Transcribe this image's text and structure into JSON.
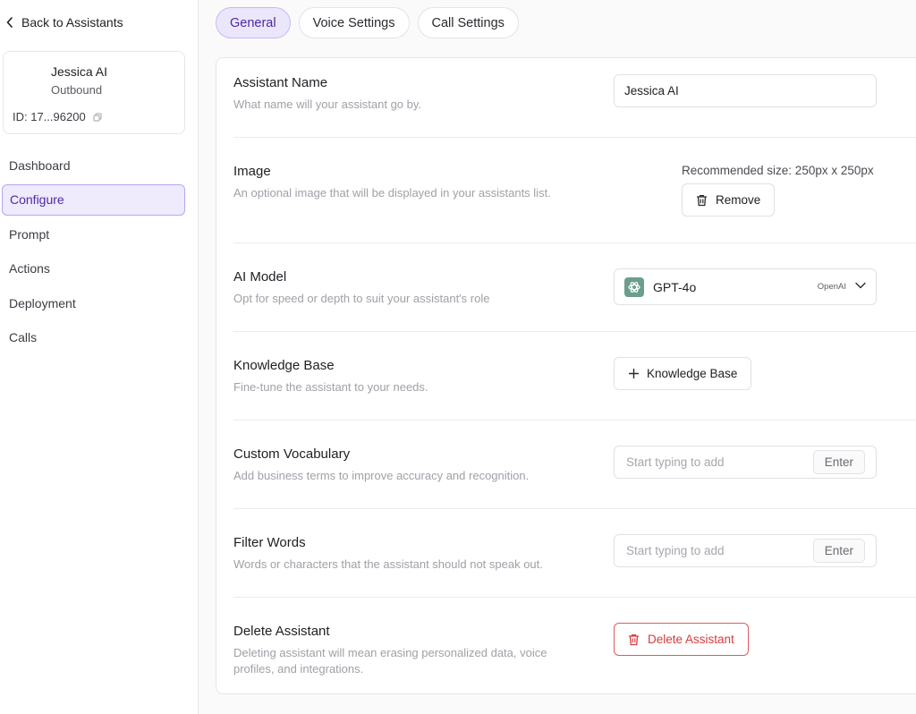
{
  "sidebar": {
    "back_label": "Back to Assistants",
    "profile": {
      "name": "Jessica AI",
      "type": "Outbound",
      "id": "ID: 17...96200"
    },
    "items": [
      {
        "label": "Dashboard"
      },
      {
        "label": "Configure"
      },
      {
        "label": "Prompt"
      },
      {
        "label": "Actions"
      },
      {
        "label": "Deployment"
      },
      {
        "label": "Calls"
      }
    ]
  },
  "tabs": [
    {
      "label": "General"
    },
    {
      "label": "Voice Settings"
    },
    {
      "label": "Call Settings"
    }
  ],
  "sections": {
    "name": {
      "title": "Assistant Name",
      "desc": "What name will your assistant go by.",
      "value": "Jessica AI"
    },
    "image": {
      "title": "Image",
      "desc": "An optional image that will be displayed in your assistants list.",
      "recommended": "Recommended size: 250px x 250px",
      "remove_label": "Remove"
    },
    "model": {
      "title": "AI Model",
      "desc": "Opt for speed or depth to suit your assistant's role",
      "selected": "GPT-4o",
      "provider": "OpenAI"
    },
    "knowledge": {
      "title": "Knowledge Base",
      "desc": "Fine-tune the assistant to your needs.",
      "button_label": "Knowledge Base"
    },
    "vocab": {
      "title": "Custom Vocabulary",
      "desc": "Add business terms to improve accuracy and recognition.",
      "placeholder": "Start typing to add",
      "enter_label": "Enter"
    },
    "filter": {
      "title": "Filter Words",
      "desc": "Words or characters that the assistant should not speak out.",
      "placeholder": "Start typing to add",
      "enter_label": "Enter"
    },
    "delete": {
      "title": "Delete Assistant",
      "desc": "Deleting assistant will mean erasing personalized data, voice profiles, and integrations.",
      "button_label": "Delete Assistant"
    }
  },
  "colors": {
    "accent": "#4b2aa3",
    "accent_bg": "#ece6fb",
    "danger": "#d43d3d"
  },
  "icons": {
    "back": "chevron-left-icon",
    "copy": "copy-icon",
    "trash": "trash-icon",
    "plus": "plus-icon",
    "model": "openai-logo-icon",
    "dropdown": "chevron-down-icon"
  }
}
